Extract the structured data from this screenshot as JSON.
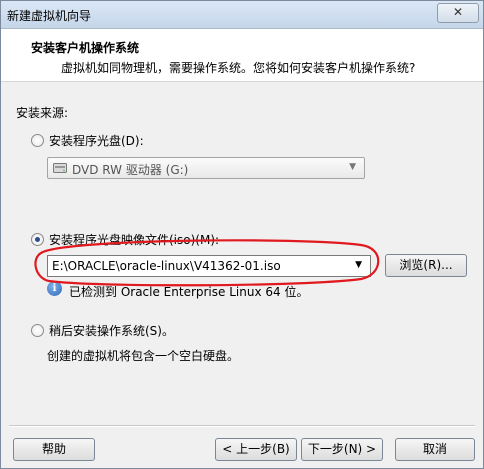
{
  "window": {
    "title": "新建虚拟机向导",
    "close_glyph": "✕"
  },
  "header": {
    "title": "安装客户机操作系统",
    "subtitle": "虚拟机如同物理机，需要操作系统。您将如何安装客户机操作系统?"
  },
  "install_source": {
    "label": "安装来源:",
    "disc_option": {
      "label": "安装程序光盘(D):",
      "selected": false,
      "drive_value": "DVD RW 驱动器 (G:)",
      "icon": "dvd-drive-icon"
    },
    "iso_option": {
      "label": "安装程序光盘映像文件(iso)(M):",
      "selected": true,
      "path_value": "E:\\ORACLE\\oracle-linux\\V41362-01.iso",
      "browse_label": "浏览(R)...",
      "detect_message": "已检测到 Oracle Enterprise Linux 64 位。",
      "icon": "info-icon"
    },
    "later_option": {
      "label": "稍后安装操作系统(S)。",
      "selected": false,
      "description": "创建的虚拟机将包含一个空白硬盘。"
    }
  },
  "footer": {
    "help_label": "帮助",
    "back_label": "< 上一步(B)",
    "next_label": "下一步(N) >",
    "cancel_label": "取消"
  },
  "colors": {
    "annotation_circle": "#e0191e",
    "radio_dot": "#2b4f8c"
  }
}
